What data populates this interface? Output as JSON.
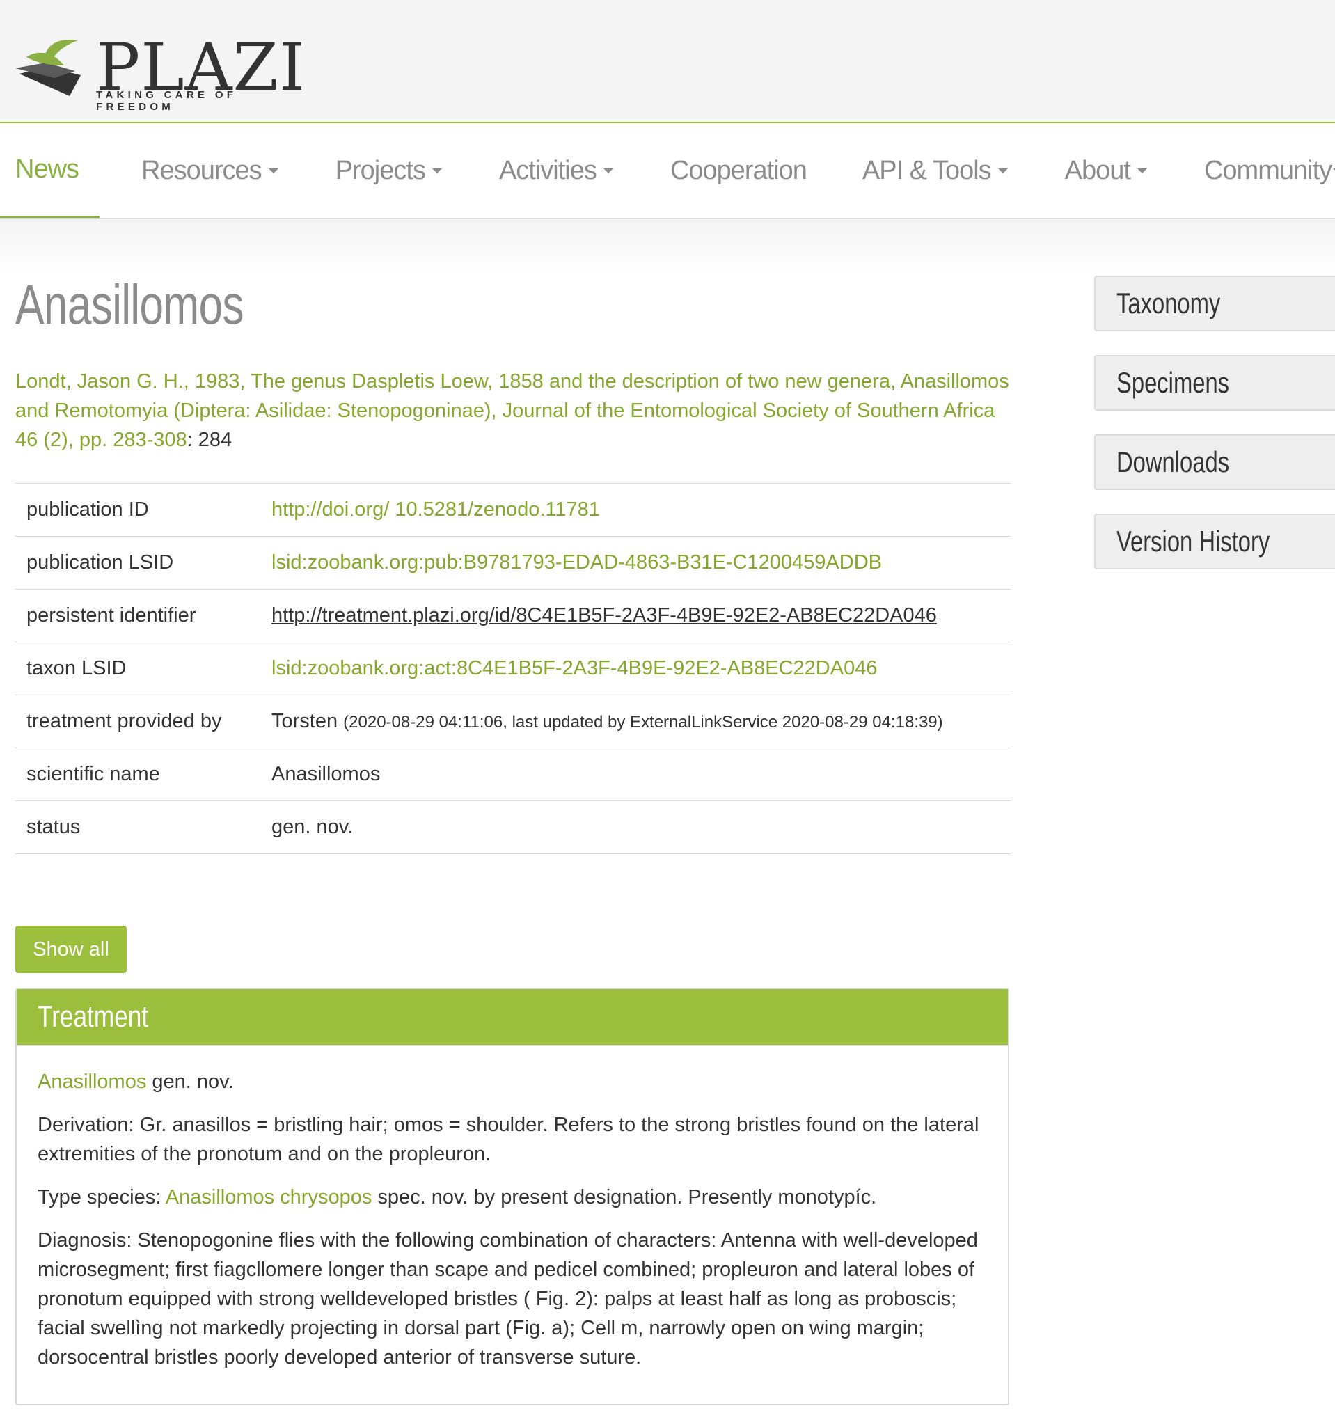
{
  "brand": {
    "name": "PLAZI",
    "tagline": "TAKING CARE OF FREEDOM",
    "colors": {
      "accent": "#9cbe3d",
      "link": "#84a82c",
      "nav_text": "#8b8b8b"
    }
  },
  "nav": {
    "items": [
      {
        "label": "News",
        "active": true,
        "dropdown": false
      },
      {
        "label": "Resources",
        "dropdown": true
      },
      {
        "label": "Projects",
        "dropdown": true
      },
      {
        "label": "Activities",
        "dropdown": true
      },
      {
        "label": "Cooperation",
        "dropdown": false
      },
      {
        "label": "API & Tools",
        "dropdown": true
      },
      {
        "label": "About",
        "dropdown": true
      },
      {
        "label": "Community",
        "dropdown": true
      }
    ]
  },
  "page": {
    "title": "Anasillomos",
    "citation_link": "Londt, Jason G. H., 1983, The genus Daspletis Loew, 1858 and the description of two new genera, Anasillomos and Remotomyia (Diptera: Asilidae: Stenopogoninae), Journal of the Entomological Society of Southern Africa 46 (2), pp. 283-308",
    "citation_suffix": ": 284"
  },
  "meta": {
    "publication_id": {
      "label": "publication ID",
      "value": "http://doi.org/ 10.5281/zenodo.11781"
    },
    "publication_lsid": {
      "label": "publication LSID",
      "value": "lsid:zoobank.org:pub:B9781793-EDAD-4863-B31E-C1200459ADDB"
    },
    "persistent_identifier": {
      "label": "persistent identifier",
      "value": "http://treatment.plazi.org/id/8C4E1B5F-2A3F-4B9E-92E2-AB8EC22DA046"
    },
    "taxon_lsid": {
      "label": "taxon LSID",
      "value": "lsid:zoobank.org:act:8C4E1B5F-2A3F-4B9E-92E2-AB8EC22DA046"
    },
    "provided_by": {
      "label": "treatment provided by",
      "value": "Torsten",
      "detail": "(2020-08-29 04:11:06, last updated by ExternalLinkService 2020-08-29 04:18:39)"
    },
    "scientific_name": {
      "label": "scientific name",
      "value": "Anasillomos"
    },
    "status": {
      "label": "status",
      "value": "gen. nov."
    }
  },
  "show_all": "Show all",
  "treatment": {
    "heading": "Treatment",
    "p1_link": "Anasillomos",
    "p1_rest": " gen. nov.",
    "p2": "Derivation: Gr. anasillos = bristling hair; omos = shoulder. Refers to the strong bristles found on the lateral extremities of the pronotum and on the propleuron.",
    "p3_pre": "Type species: ",
    "p3_link": "Anasillomos chrysopos",
    "p3_post": " spec. nov. by present designation. Presently monotypíc.",
    "p4": "Diagnosis: Stenopogonine flies with the following combination of characters: Antenna with well-developed microsegment; first fiagcllomere longer than scape and pedicel combined; propleuron and lateral lobes of pronotum equipped with strong welldeveloped bristles ( Fig. 2): palps at least half as long as proboscis; facial swellìng not markedly projecting in dorsal part (Fig. a); Cell m, narrowly open on wing margin; dorsocentral bristles poorly developed anterior of transverse suture."
  },
  "sidebar": {
    "items": [
      {
        "label": "Taxonomy"
      },
      {
        "label": "Specimens"
      },
      {
        "label": "Downloads"
      },
      {
        "label": "Version History"
      }
    ]
  },
  "icons": {
    "logo": "plazi-leaf-logo-icon",
    "dropdown": "caret-down-icon"
  }
}
